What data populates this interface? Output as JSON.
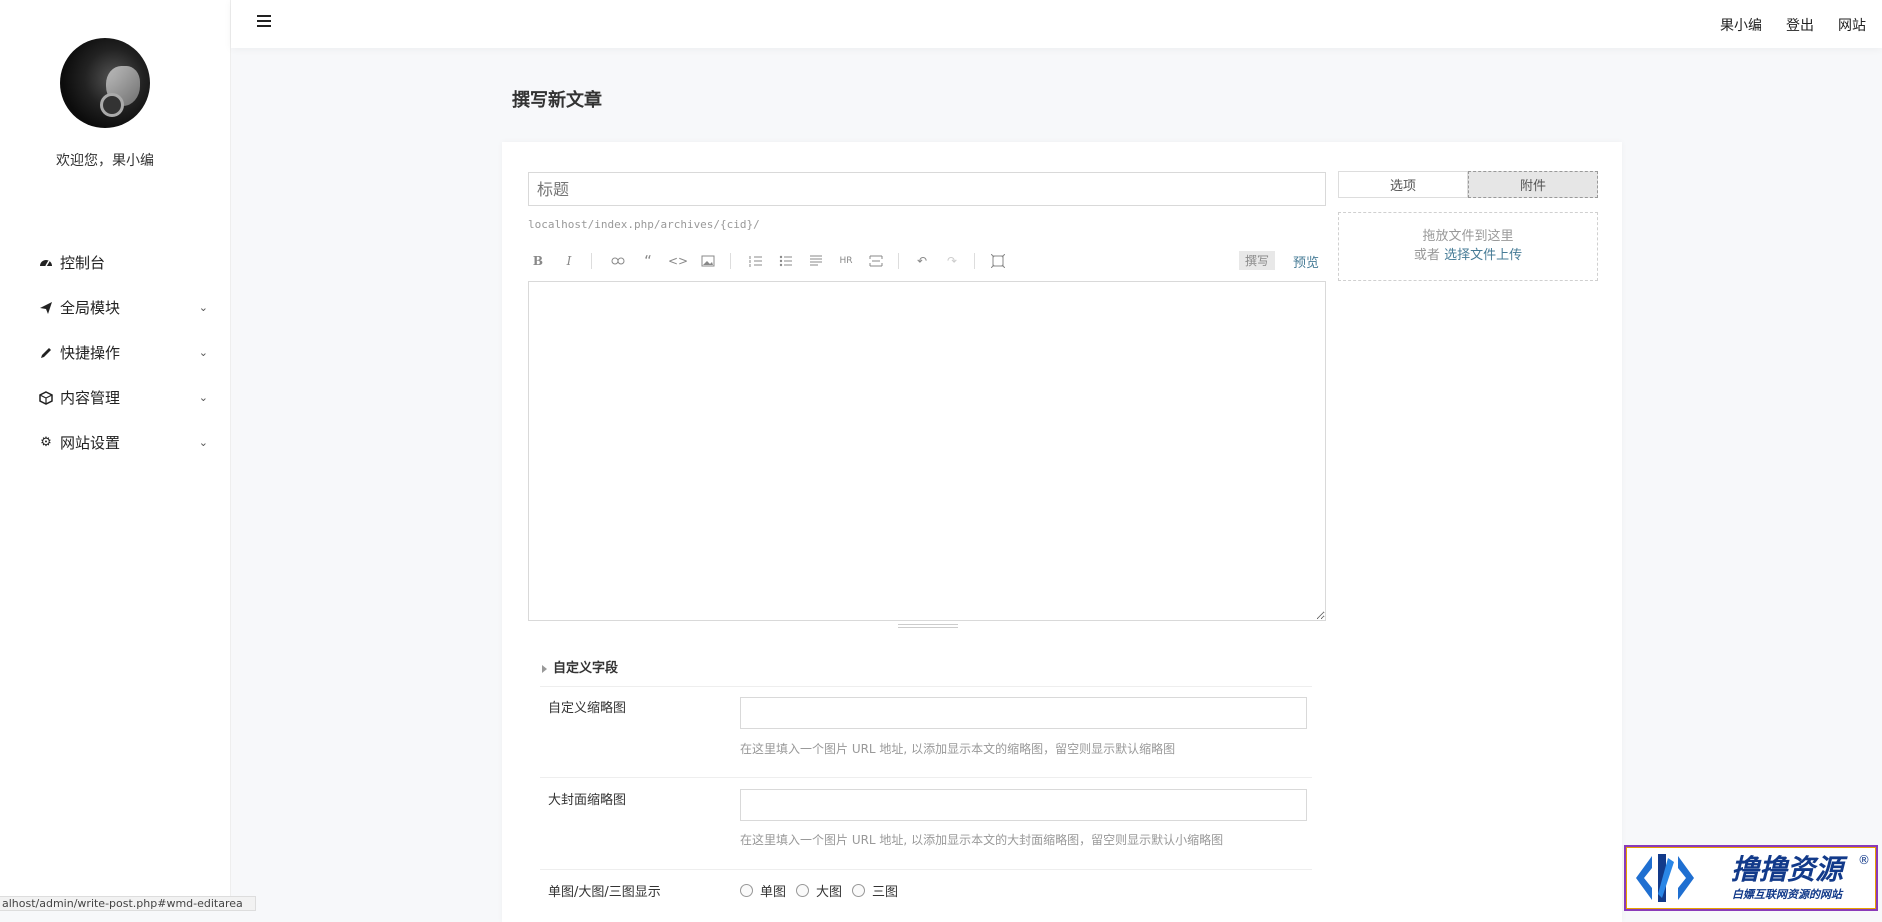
{
  "sidebar": {
    "welcome": "欢迎您，果小编",
    "items": [
      {
        "label": "控制台",
        "icon": "dashboard-icon"
      },
      {
        "label": "全局模块",
        "icon": "paper-plane-icon"
      },
      {
        "label": "快捷操作",
        "icon": "pencil-icon"
      },
      {
        "label": "内容管理",
        "icon": "cube-icon"
      },
      {
        "label": "网站设置",
        "icon": "gear-icon"
      }
    ]
  },
  "topbar": {
    "user": "果小编",
    "logout": "登出",
    "site": "网站"
  },
  "page": {
    "title": "撰写新文章"
  },
  "editor": {
    "title_placeholder": "标题",
    "permalink": "localhost/index.php/archives/{cid}/",
    "tab_write": "撰写",
    "tab_preview": "预览"
  },
  "right_panel": {
    "tab_options": "选项",
    "tab_attachments": "附件",
    "upload_hint": "拖放文件到这里",
    "upload_or": "或者",
    "upload_link": "选择文件上传"
  },
  "custom_fields": {
    "heading": "自定义字段",
    "thumb_label": "自定义缩略图",
    "thumb_desc": "在这里填入一个图片 URL 地址, 以添加显示本文的缩略图，留空则显示默认缩略图",
    "cover_label": "大封面缩略图",
    "cover_desc": "在这里填入一个图片 URL 地址, 以添加显示本文的大封面缩略图，留空则显示默认小缩略图",
    "display_label": "单图/大图/三图显示",
    "options": [
      "单图",
      "大图",
      "三图"
    ]
  },
  "statusbar": {
    "url": "alhost/admin/write-post.php#wmd-editarea"
  },
  "watermark": {
    "brand": "撸撸资源",
    "slogan": "白嫖互联网资源的网站",
    "reg": "®"
  }
}
